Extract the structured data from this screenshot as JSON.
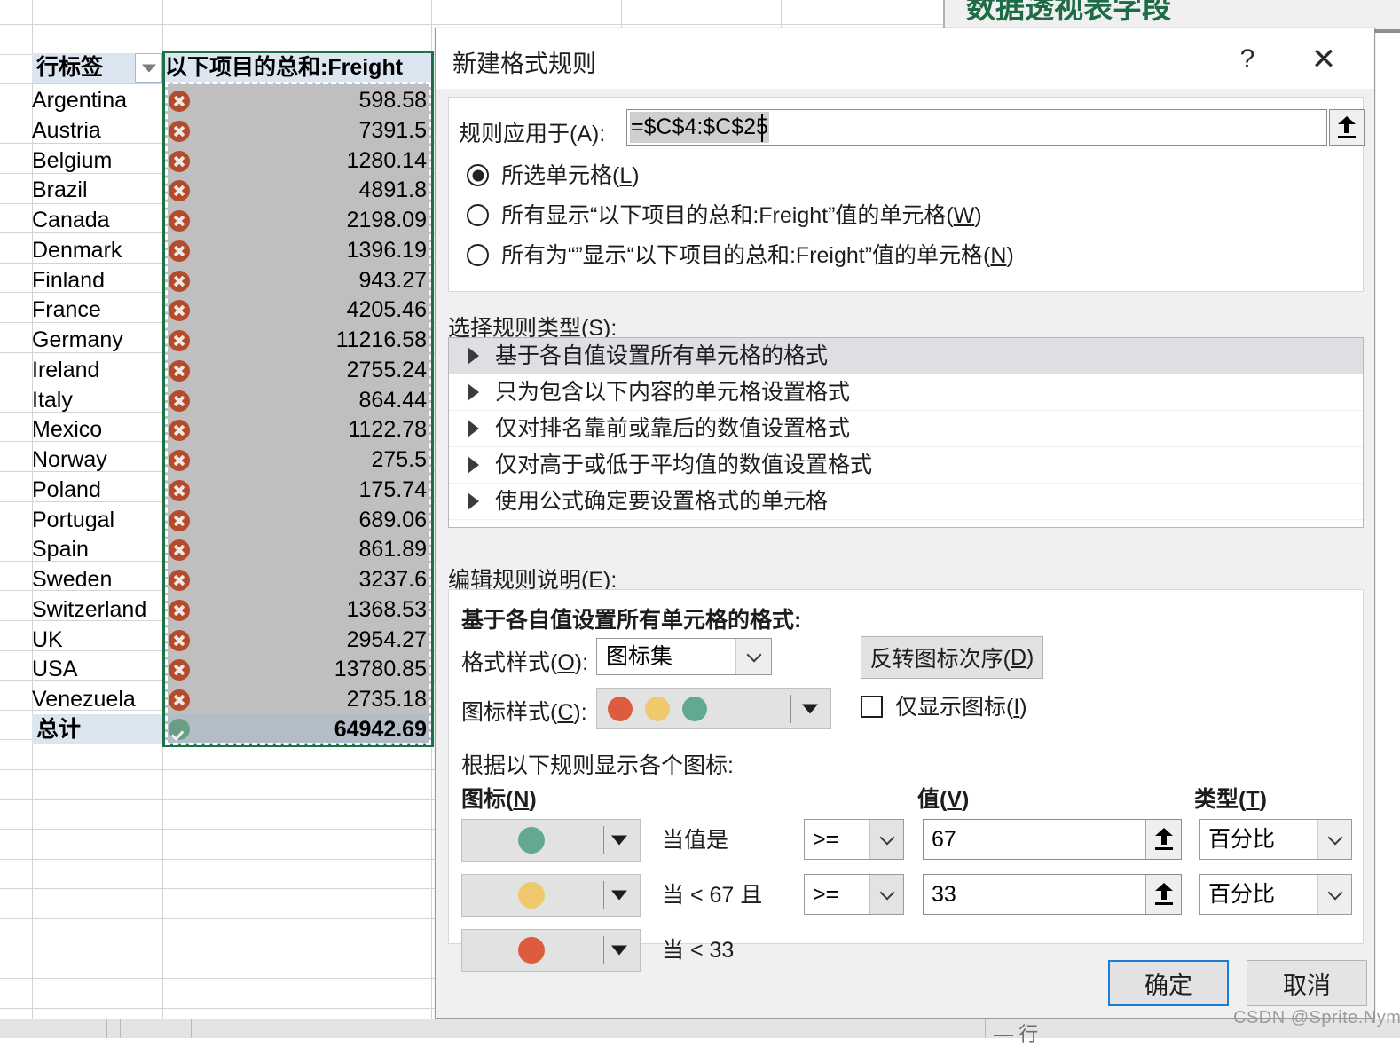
{
  "sheet": {
    "header": {
      "row_label": "行标签",
      "filter_icon": "chevron-down-icon",
      "value_label": "以下项目的总和:Freight"
    },
    "rows": [
      {
        "country": "Argentina",
        "value": "598.58",
        "icon": "red-x-icon"
      },
      {
        "country": "Austria",
        "value": "7391.5",
        "icon": "red-x-icon"
      },
      {
        "country": "Belgium",
        "value": "1280.14",
        "icon": "red-x-icon"
      },
      {
        "country": "Brazil",
        "value": "4891.8",
        "icon": "red-x-icon"
      },
      {
        "country": "Canada",
        "value": "2198.09",
        "icon": "red-x-icon"
      },
      {
        "country": "Denmark",
        "value": "1396.19",
        "icon": "red-x-icon"
      },
      {
        "country": "Finland",
        "value": "943.27",
        "icon": "red-x-icon"
      },
      {
        "country": "France",
        "value": "4205.46",
        "icon": "red-x-icon"
      },
      {
        "country": "Germany",
        "value": "11216.58",
        "icon": "red-x-icon"
      },
      {
        "country": "Ireland",
        "value": "2755.24",
        "icon": "red-x-icon"
      },
      {
        "country": "Italy",
        "value": "864.44",
        "icon": "red-x-icon"
      },
      {
        "country": "Mexico",
        "value": "1122.78",
        "icon": "red-x-icon"
      },
      {
        "country": "Norway",
        "value": "275.5",
        "icon": "red-x-icon"
      },
      {
        "country": "Poland",
        "value": "175.74",
        "icon": "red-x-icon"
      },
      {
        "country": "Portugal",
        "value": "689.06",
        "icon": "red-x-icon"
      },
      {
        "country": "Spain",
        "value": "861.89",
        "icon": "red-x-icon"
      },
      {
        "country": "Sweden",
        "value": "3237.6",
        "icon": "red-x-icon"
      },
      {
        "country": "Switzerland",
        "value": "1368.53",
        "icon": "red-x-icon"
      },
      {
        "country": "UK",
        "value": "2954.27",
        "icon": "red-x-icon"
      },
      {
        "country": "USA",
        "value": "13780.85",
        "icon": "red-x-icon"
      },
      {
        "country": "Venezuela",
        "value": "2735.18",
        "icon": "red-x-icon"
      }
    ],
    "total": {
      "label": "总计",
      "value": "64942.69",
      "icon": "green-check-icon"
    },
    "selection_range": "C4:C25"
  },
  "pivot_panel": {
    "title": "数据透视表字段"
  },
  "dialog": {
    "title": "新建格式规则",
    "help_glyph": "?",
    "close_glyph": "✕",
    "applies_to": {
      "label": "规则应用于(A):",
      "value": "=$C$4:$C$25",
      "picker_icon": "range-picker-icon",
      "options": [
        {
          "label_pre": "所选单元格(",
          "accel": "L",
          "label_post": ")",
          "selected": true
        },
        {
          "label_pre": "所有显示“以下项目的总和:Freight”值的单元格(",
          "accel": "W",
          "label_post": ")",
          "selected": false
        },
        {
          "label_pre": "所有为“”显示“以下项目的总和:Freight”值的单元格(",
          "accel": "N",
          "label_post": ")",
          "selected": false
        }
      ]
    },
    "rule_type": {
      "label": "选择规则类型(S):",
      "items": [
        {
          "text": "基于各自值设置所有单元格的格式",
          "selected": true
        },
        {
          "text": "只为包含以下内容的单元格设置格式",
          "selected": false
        },
        {
          "text": "仅对排名靠前或靠后的数值设置格式",
          "selected": false
        },
        {
          "text": "仅对高于或低于平均值的数值设置格式",
          "selected": false
        },
        {
          "text": "使用公式确定要设置格式的单元格",
          "selected": false
        }
      ]
    },
    "edit_description": {
      "label": "编辑规则说明(E):",
      "heading": "基于各自值设置所有单元格的格式:",
      "format_style": {
        "label_pre": "格式样式(",
        "accel": "O",
        "label_post": "):",
        "value": "图标集"
      },
      "reverse_button": {
        "label_pre": "反转图标次序(",
        "accel": "D",
        "label_post": ")"
      },
      "icon_style": {
        "label_pre": "图标样式(",
        "accel": "C",
        "label_post": "):",
        "colors": [
          "#dd5b3e",
          "#f0c96e",
          "#63a892"
        ]
      },
      "icons_only": {
        "label_pre": "仅显示图标(",
        "accel": "I",
        "label_post": ")",
        "checked": false
      },
      "rules_caption": "根据以下规则显示各个图标:",
      "columns": [
        {
          "label_pre": "图标(",
          "accel": "N",
          "label_post": ")"
        },
        {
          "label_pre": "值(",
          "accel": "V",
          "label_post": ")"
        },
        {
          "label_pre": "类型(",
          "accel": "T",
          "label_post": ")"
        }
      ],
      "rules": [
        {
          "icon_color": "#63a892",
          "condition": "当值是",
          "operator": ">=",
          "value": "67",
          "type": "百分比"
        },
        {
          "icon_color": "#f0c96e",
          "condition": "当 < 67 且",
          "operator": ">=",
          "value": "33",
          "type": "百分比"
        },
        {
          "icon_color": "#dd5b3e",
          "condition": "当 < 33",
          "operator": "",
          "value": "",
          "type": ""
        }
      ]
    },
    "footer": {
      "ok": "确定",
      "cancel": "取消"
    }
  },
  "watermark": "CSDN @Sprite.Nym",
  "bottom_ghost": "— 行"
}
